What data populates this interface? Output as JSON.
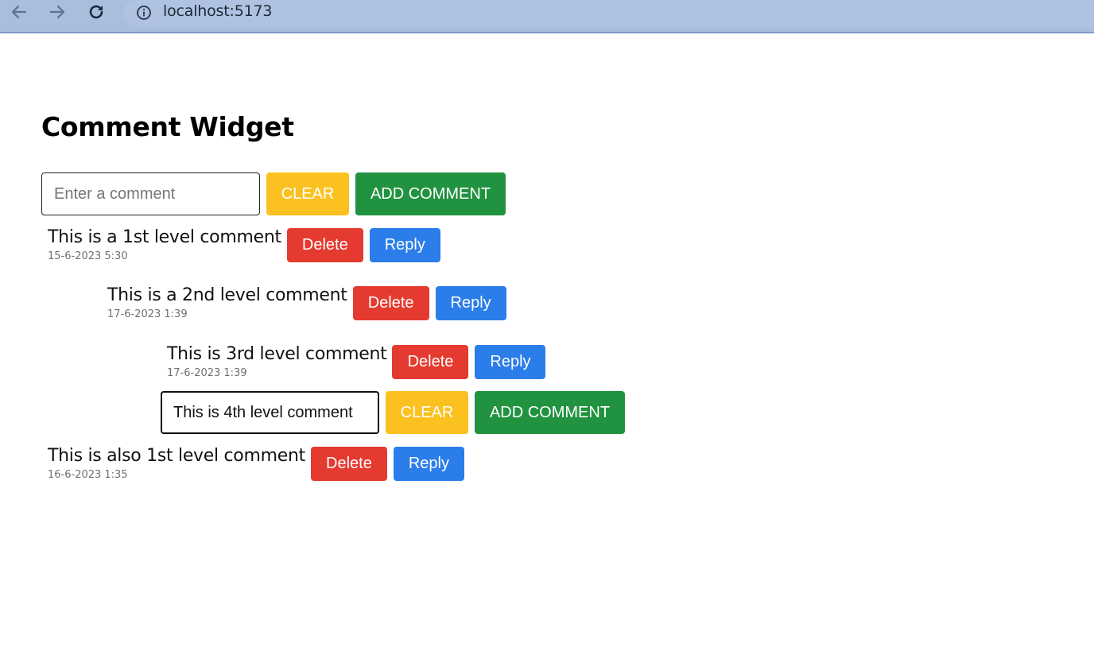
{
  "browser": {
    "url": "localhost:5173",
    "icons": {
      "back": "arrow-left-icon",
      "forward": "arrow-right-icon",
      "reload": "reload-icon",
      "info": "info-icon"
    }
  },
  "page": {
    "title": "Comment Widget"
  },
  "top_input": {
    "placeholder": "Enter a comment",
    "value": "",
    "clear_label": "CLEAR",
    "add_label": "ADD COMMENT"
  },
  "comments": [
    {
      "text": "This is a 1st level comment",
      "timestamp": "15-6-2023 5:30",
      "delete_label": "Delete",
      "reply_label": "Reply"
    },
    {
      "text": "This is a 2nd level comment",
      "timestamp": "17-6-2023 1:39",
      "delete_label": "Delete",
      "reply_label": "Reply"
    },
    {
      "text": "This is 3rd level comment",
      "timestamp": "17-6-2023 1:39",
      "delete_label": "Delete",
      "reply_label": "Reply"
    },
    {
      "text": "This is also 1st level comment",
      "timestamp": "16-6-2023 1:35",
      "delete_label": "Delete",
      "reply_label": "Reply"
    }
  ],
  "reply_input": {
    "value": "This is 4th level comment",
    "clear_label": "CLEAR",
    "add_label": "ADD COMMENT"
  },
  "colors": {
    "clear": "#fbc121",
    "add": "#21923f",
    "delete": "#e53a2f",
    "reply": "#2b7de9"
  }
}
